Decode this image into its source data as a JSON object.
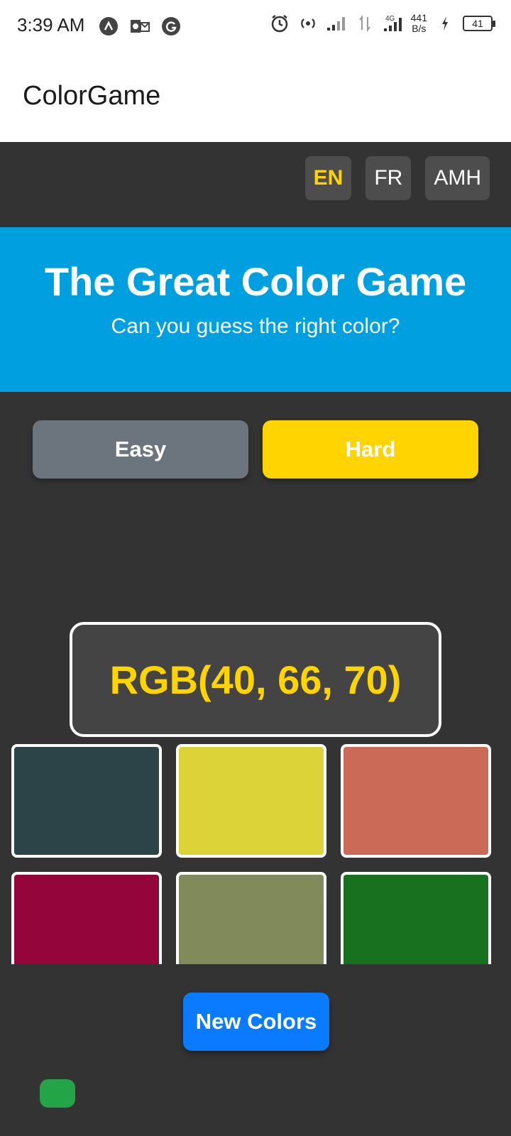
{
  "status_bar": {
    "time": "3:39 AM",
    "net_speed_value": "441",
    "net_speed_unit": "B/s",
    "network_type": "4G",
    "battery": "41"
  },
  "app_bar": {
    "title": "ColorGame"
  },
  "languages": [
    {
      "label": "EN",
      "active": true
    },
    {
      "label": "FR",
      "active": false
    },
    {
      "label": "AMH",
      "active": false
    }
  ],
  "banner": {
    "title": "The Great Color Game",
    "subtitle": "Can you guess the right color?",
    "color": "#00a0e0"
  },
  "modes": {
    "easy_label": "Easy",
    "hard_label": "Hard",
    "selected": "Hard"
  },
  "target": {
    "rgb_text": "RGB(40, 66, 70)"
  },
  "swatches": [
    {
      "color": "#2c4347"
    },
    {
      "color": "#dbd338"
    },
    {
      "color": "#cb6b57"
    },
    {
      "color": "#93053b"
    },
    {
      "color": "#818a5a"
    },
    {
      "color": "#18711f"
    }
  ],
  "actions": {
    "new_colors_label": "New Colors"
  },
  "colors": {
    "background": "#333333",
    "accent_yellow": "#ffd400",
    "primary_blue": "#0a7bff",
    "status_green": "#23a447"
  }
}
